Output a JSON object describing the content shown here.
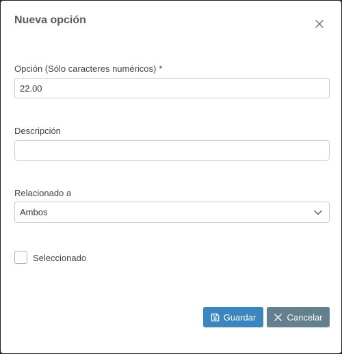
{
  "dialog": {
    "title": "Nueva opción",
    "close_icon": "close-icon"
  },
  "fields": {
    "option": {
      "label": "Opción (Sólo caracteres numéricos)",
      "required_mark": "*",
      "value": "22.00"
    },
    "description": {
      "label": "Descripción",
      "value": ""
    },
    "related": {
      "label": "Relacionado a",
      "selected": "Ambos",
      "icon": "chevron-down-icon"
    },
    "selected_checkbox": {
      "label": "Seleccionado",
      "checked": false
    }
  },
  "actions": {
    "save_label": "Guardar",
    "save_icon": "save-icon",
    "cancel_label": "Cancelar",
    "cancel_icon": "close-icon"
  },
  "colors": {
    "primary": "#3a86c0",
    "secondary": "#64808f"
  }
}
